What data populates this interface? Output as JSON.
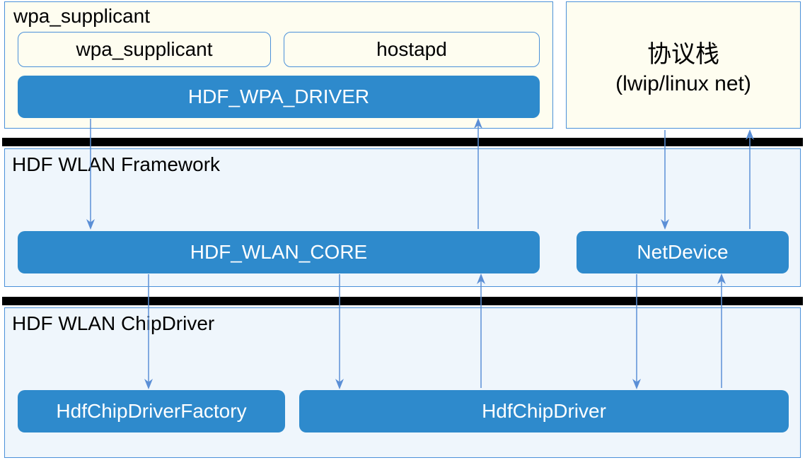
{
  "layers": {
    "top_left": {
      "title": "wpa_supplicant",
      "sub_box_left": "wpa_supplicant",
      "sub_box_right": "hostapd",
      "driver": "HDF_WPA_DRIVER"
    },
    "top_right": {
      "title_line1": "协议栈",
      "title_line2": "(lwip/linux net)"
    },
    "middle": {
      "title": "HDF WLAN Framework",
      "core": "HDF_WLAN_CORE",
      "netdevice": "NetDevice"
    },
    "bottom": {
      "title": "HDF WLAN ChipDriver",
      "factory": "HdfChipDriverFactory",
      "driver": "HdfChipDriver"
    }
  },
  "colors": {
    "block_blue": "#2E8ACC",
    "border_blue": "#4A90D9",
    "arrow_blue": "#5B8FD6",
    "cream": "#FEFDF0",
    "light": "#EFF6FC"
  }
}
